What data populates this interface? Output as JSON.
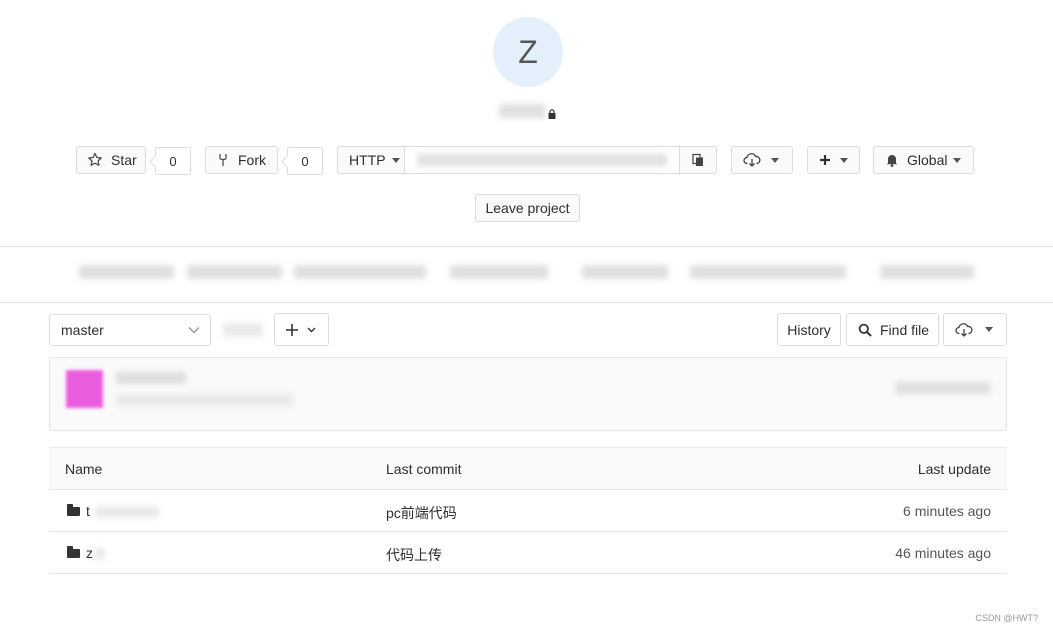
{
  "project": {
    "avatar_letter": "Z",
    "colors": {
      "avatar_bg": "#e3f0fc",
      "avatar_fg": "#555555"
    }
  },
  "actions": {
    "star_label": "Star",
    "star_count": "0",
    "fork_label": "Fork",
    "fork_count": "0",
    "protocol_label": "HTTP",
    "global_label": "Global",
    "leave_label": "Leave project"
  },
  "repo": {
    "branch": "master",
    "history_label": "History",
    "find_file_label": "Find file"
  },
  "table": {
    "headers": [
      "Name",
      "Last commit",
      "Last update"
    ],
    "rows": [
      {
        "name": "t",
        "commit": "pc前端代码",
        "updated": "6 minutes ago"
      },
      {
        "name": "z",
        "commit": "代码上传",
        "updated": "46 minutes ago"
      }
    ]
  },
  "watermark": "CSDN @HWT?"
}
